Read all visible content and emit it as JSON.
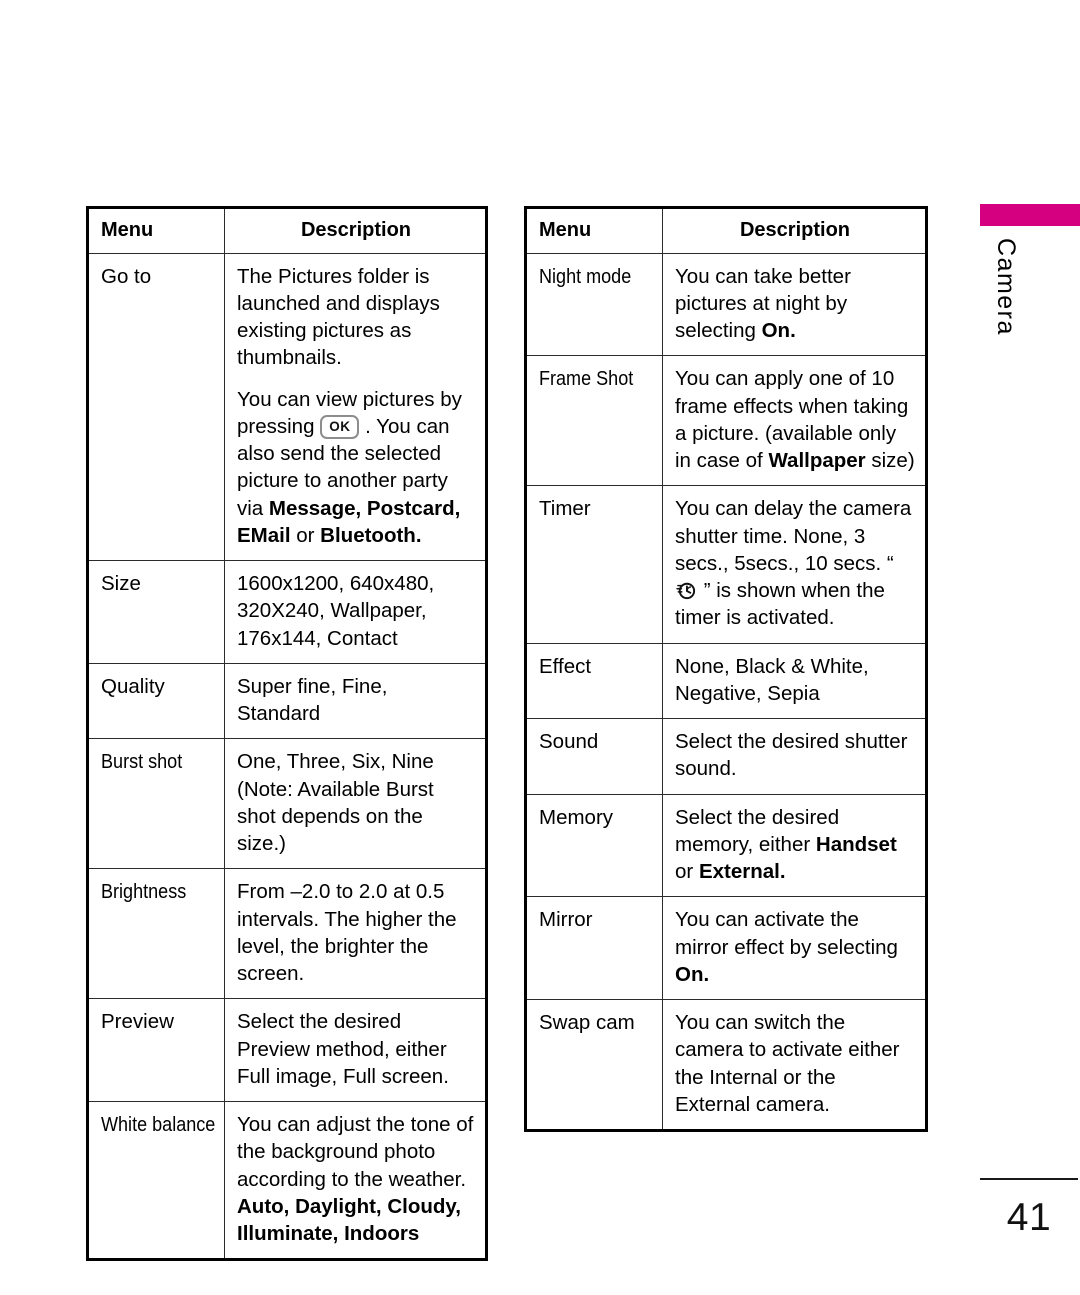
{
  "page": {
    "number": "41",
    "chapter_tab_label": "Camera",
    "tab_color": "#d4007f"
  },
  "tables": [
    {
      "id": "camera-settings-table-1",
      "headers": {
        "menu": "Menu",
        "description": "Description"
      },
      "rows": [
        {
          "menu": "Go to",
          "paragraphs": [
            {
              "parts": [
                {
                  "t": "The Pictures folder is launched and displays existing pictures as thumbnails."
                }
              ]
            },
            {
              "parts": [
                {
                  "t": "You can view pictures by pressing "
                },
                {
                  "icon": "ok-key",
                  "label": "OK"
                },
                {
                  "t": " . You can also send the selected picture to another party via "
                },
                {
                  "t": "Message, Postcard, EMail",
                  "b": true
                },
                {
                  "t": " or "
                },
                {
                  "t": "Bluetooth.",
                  "b": true
                }
              ]
            }
          ]
        },
        {
          "menu": "Size",
          "paragraphs": [
            {
              "parts": [
                {
                  "t": "1600x1200, 640x480, 320X240, Wallpaper, 176x144, Contact"
                }
              ]
            }
          ]
        },
        {
          "menu": "Quality",
          "paragraphs": [
            {
              "parts": [
                {
                  "t": "Super fine, Fine, Standard"
                }
              ]
            }
          ]
        },
        {
          "menu": "Burst shot",
          "paragraphs": [
            {
              "parts": [
                {
                  "t": "One, Three, Six, Nine (Note: Available Burst shot depends on the size.)"
                }
              ]
            }
          ]
        },
        {
          "menu": "Brightness",
          "paragraphs": [
            {
              "parts": [
                {
                  "t": "From –2.0 to 2.0 at 0.5 intervals. The higher the level, the brighter the screen."
                }
              ]
            }
          ]
        },
        {
          "menu": "Preview",
          "paragraphs": [
            {
              "parts": [
                {
                  "t": "Select the desired Preview method, either Full image, Full screen."
                }
              ]
            }
          ]
        },
        {
          "menu": "White balance",
          "paragraphs": [
            {
              "parts": [
                {
                  "t": "You can adjust the tone of the background photo according to the weather. "
                },
                {
                  "t": "Auto, Daylight, Cloudy, Illuminate, Indoors",
                  "b": true
                }
              ]
            }
          ]
        }
      ]
    },
    {
      "id": "camera-settings-table-2",
      "headers": {
        "menu": "Menu",
        "description": "Description"
      },
      "rows": [
        {
          "menu": "Night mode",
          "paragraphs": [
            {
              "parts": [
                {
                  "t": "You can take better pictures at night by selecting "
                },
                {
                  "t": "On.",
                  "b": true
                }
              ]
            }
          ]
        },
        {
          "menu": "Frame Shot",
          "paragraphs": [
            {
              "parts": [
                {
                  "t": "You can apply one of 10 frame effects when taking a picture. (available only in case of "
                },
                {
                  "t": "Wallpaper",
                  "b": true
                },
                {
                  "t": " size)"
                }
              ]
            }
          ]
        },
        {
          "menu": "Timer",
          "paragraphs": [
            {
              "parts": [
                {
                  "t": "You can delay the camera shutter time. None, 3 secs., 5secs., 10 secs. “ "
                },
                {
                  "icon": "timer-icon"
                },
                {
                  "t": " ” is shown when the timer is activated."
                }
              ]
            }
          ]
        },
        {
          "menu": "Effect",
          "paragraphs": [
            {
              "parts": [
                {
                  "t": "None, Black & White, Negative, Sepia"
                }
              ]
            }
          ]
        },
        {
          "menu": "Sound",
          "paragraphs": [
            {
              "parts": [
                {
                  "t": "Select the desired shutter sound."
                }
              ]
            }
          ]
        },
        {
          "menu": "Memory",
          "paragraphs": [
            {
              "parts": [
                {
                  "t": "Select the desired memory, either "
                },
                {
                  "t": "Handset",
                  "b": true
                },
                {
                  "t": " or "
                },
                {
                  "t": "External.",
                  "b": true
                }
              ]
            }
          ]
        },
        {
          "menu": "Mirror",
          "paragraphs": [
            {
              "parts": [
                {
                  "t": "You can activate the mirror effect by selecting "
                },
                {
                  "t": "On.",
                  "b": true
                }
              ]
            }
          ]
        },
        {
          "menu": "Swap cam",
          "paragraphs": [
            {
              "parts": [
                {
                  "t": "You can switch the camera to activate either the Internal or the External camera."
                }
              ]
            }
          ]
        }
      ]
    }
  ]
}
